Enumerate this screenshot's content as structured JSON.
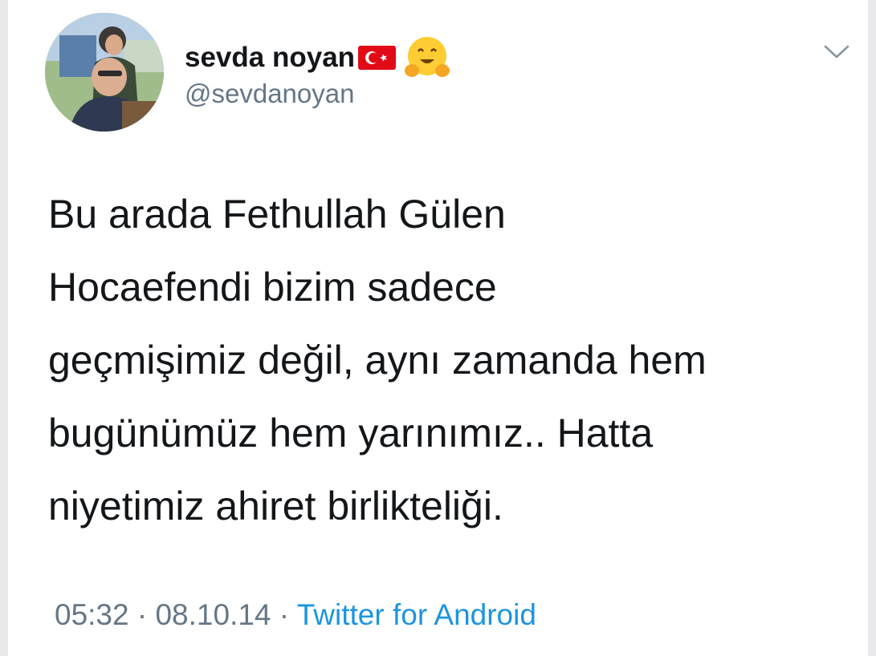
{
  "user": {
    "display_name": "sevda noyan",
    "handle": "@sevdanoyan",
    "flag_icon": "turkey-flag-icon",
    "emoji_icon": "hugging-face-icon"
  },
  "tweet": {
    "lines": [
      "Bu arada Fethullah Gülen",
      "Hocaefendi bizim sadece",
      "geçmişimiz değil, aynı zamanda hem",
      "bugünümüz hem yarınımız.. Hatta",
      "niyetimiz ahiret birlikteliği."
    ]
  },
  "meta": {
    "time": "05:32",
    "separator": " · ",
    "date": "08.10.14",
    "source": "Twitter for Android"
  },
  "colors": {
    "text": "#14171a",
    "secondary": "#657786",
    "link": "#1b95e0",
    "flag_red": "#e30a17"
  }
}
